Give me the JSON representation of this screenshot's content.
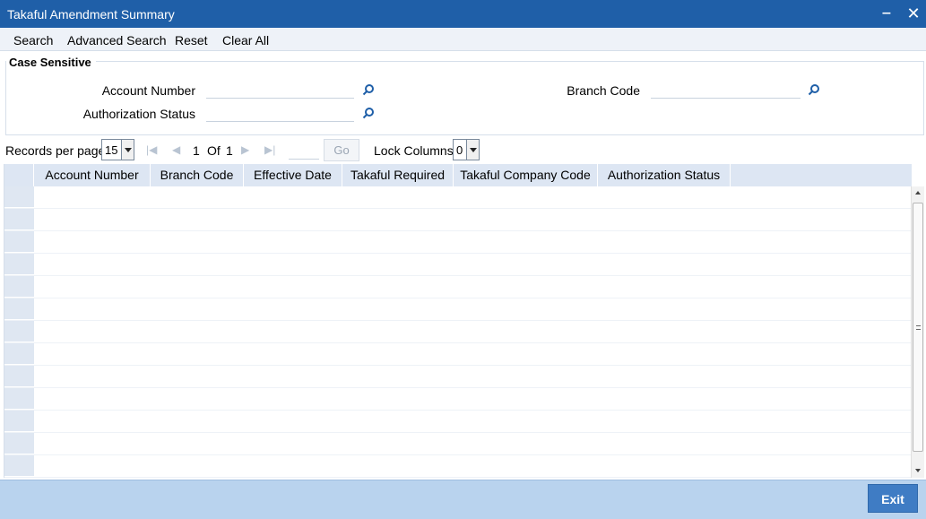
{
  "window": {
    "title": "Takaful Amendment Summary",
    "minimize_glyph": "‒",
    "close_glyph": "✕"
  },
  "menu": [
    {
      "label": "Search"
    },
    {
      "label": "Advanced Search"
    },
    {
      "label": "Reset"
    },
    {
      "label": "Clear All"
    }
  ],
  "criteria": {
    "legend": "Case Sensitive",
    "fields": {
      "account_number": {
        "label": "Account Number",
        "value": "",
        "icon": "search-icon"
      },
      "branch_code": {
        "label": "Branch Code",
        "value": "",
        "icon": "search-icon"
      },
      "authorization_status": {
        "label": "Authorization Status",
        "value": "",
        "icon": "search-icon"
      }
    }
  },
  "pager": {
    "records_label": "Records per page",
    "records_value": "15",
    "current_page": "1",
    "of_label": "Of",
    "total_pages": "1",
    "goto_value": "",
    "go_label": "Go",
    "lock_label": "Lock Columns",
    "lock_value": "0"
  },
  "grid": {
    "columns": [
      "Account Number",
      "Branch Code",
      "Effective Date",
      "Takaful Required",
      "Takaful Company Code",
      "Authorization Status"
    ],
    "rows": [],
    "empty_row_count": 13
  },
  "footer": {
    "exit_label": "Exit"
  },
  "colors": {
    "titlebar": "#1f5fa8",
    "header": "#dde6f3",
    "footer": "#b9d3ee",
    "button": "#3f7cc4"
  }
}
